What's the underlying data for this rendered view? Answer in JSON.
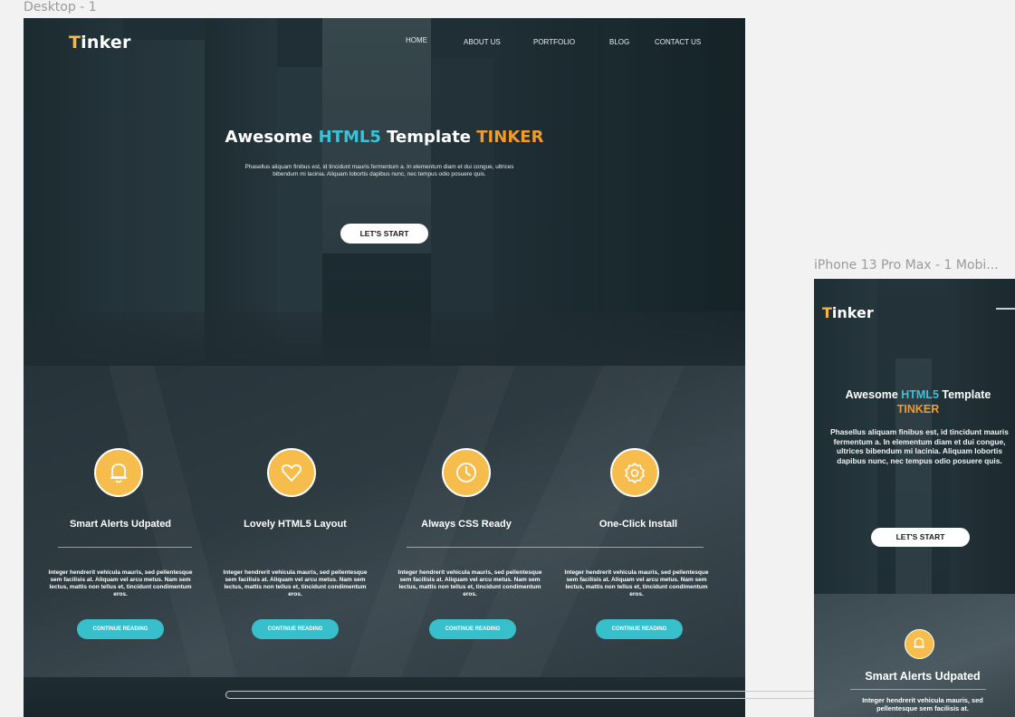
{
  "frames": {
    "desktop_label": "Desktop - 1",
    "mobile_label": "iPhone 13 Pro Max - 1 Mobi..."
  },
  "brand": {
    "first_letter": "T",
    "rest": "inker",
    "accent_color": "#f5b846"
  },
  "nav": {
    "items": [
      {
        "label": "HOME"
      },
      {
        "label": "ABOUT US"
      },
      {
        "label": "PORTFOLIO"
      },
      {
        "label": "BLOG"
      },
      {
        "label": "CONTACT US"
      }
    ]
  },
  "hero": {
    "title_pre": "Awesome ",
    "title_html5": "HTML5",
    "title_mid": " Template ",
    "title_tinker": "TINKER",
    "subtitle": "Phasellus aliquam finibus est, id tincidunt mauris fermentum a. In elementum diam et dui congue, ultrices bibendum mi lacinia. Aliquam lobortis dapibus nunc, nec tempus odio posuere quis.",
    "cta": "LET'S START",
    "colors": {
      "blue": "#3cc2d6",
      "orange": "#f39a2b"
    }
  },
  "features": [
    {
      "icon": "bell-icon",
      "title": "Smart Alerts Udpated",
      "text": "Integer hendrerit vehicula mauris, sed pellentesque sem facilisis at. Aliquam vel arcu metus. Nam sem lectus, mattis non tellus et, tincidunt condimentum eros.",
      "button": "CONTINUE READING"
    },
    {
      "icon": "heart-icon",
      "title": "Lovely HTML5  Layout",
      "text": "Integer hendrerit vehicula mauris, sed pellentesque sem facilisis at. Aliquam vel arcu metus. Nam sem lectus, mattis non tellus et, tincidunt condimentum eros.",
      "button": "CONTINUE READING"
    },
    {
      "icon": "clock-icon",
      "title": "Always CSS Ready",
      "text": "Integer hendrerit vehicula mauris, sed pellentesque sem facilisis at. Aliquam vel arcu metus. Nam sem lectus, mattis non tellus et, tincidunt condimentum eros.",
      "button": "CONTINUE READING"
    },
    {
      "icon": "gear-icon",
      "title": "One-Click Install",
      "text": "Integer hendrerit vehicula mauris, sed pellentesque sem facilisis at. Aliquam vel arcu metus. Nam sem lectus, mattis non tellus et, tincidunt condimentum eros.",
      "button": "CONTINUE READING"
    }
  ],
  "mobile": {
    "title_line1_pre": "Awesome ",
    "title_line1_html5": "HTML5",
    "title_line1_post": " Template",
    "title_line2": "TINKER",
    "subtitle": "Phasellus aliquam finibus est, id tincidunt mauris fermentum a. In elementum diam et dui congue, ultrices bibendum mi lacinia. Aliquam lobortis dapibus nunc, nec tempus odio posuere quis.",
    "cta": "LET'S START",
    "feature_title": "Smart Alerts Udpated",
    "feature_text": "Integer hendrerit vehicula mauris, sed pellentesque sem facilisis at.",
    "menu_icon": "hamburger-menu-icon"
  },
  "colors": {
    "icon_circle": "#f6bd4d",
    "teal_button": "#37bfcc"
  }
}
